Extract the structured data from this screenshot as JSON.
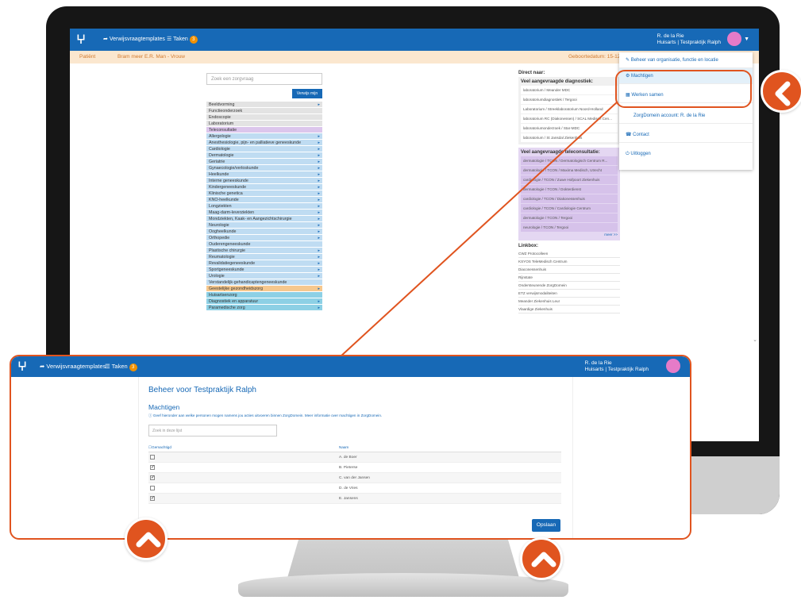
{
  "topbar": {
    "nav_questions": "Verwijsvraagtemplates",
    "nav_tasks": "Taken",
    "tasks_count": "3",
    "user_name": "R. de la Rie",
    "user_org": "Huisarts | Testpraktijk Ralph"
  },
  "patientbar": {
    "patient_label": "Patiënt",
    "patient_name": "Bram meer E.R. Man - Vrouw",
    "birth_label": "Geboortedatum: 15-12-"
  },
  "main": {
    "search_placeholder": "Zoek een zorgvraag",
    "search_button": "Verwijs mijn",
    "specialties": [
      {
        "label": "Beeldvorming",
        "c": "gray",
        "arrow": true
      },
      {
        "label": "Functieonderzoek",
        "c": "gray",
        "arrow": false
      },
      {
        "label": "Endoscopie",
        "c": "gray",
        "arrow": false
      },
      {
        "label": "Laboratorium",
        "c": "gray",
        "arrow": false
      },
      {
        "label": "Teleconsultatie",
        "c": "lav",
        "arrow": false
      },
      {
        "label": "Allergologie",
        "c": "blue",
        "arrow": true
      },
      {
        "label": "Anesthesiologie, pijn- en palliatieve geneeskunde",
        "c": "blue",
        "arrow": true
      },
      {
        "label": "Cardiologie",
        "c": "blue",
        "arrow": true
      },
      {
        "label": "Dermatologie",
        "c": "blue",
        "arrow": true
      },
      {
        "label": "Geriatrie",
        "c": "blue",
        "arrow": true
      },
      {
        "label": "Gynaecologie/verloskunde",
        "c": "blue",
        "arrow": true
      },
      {
        "label": "Heelkunde",
        "c": "blue",
        "arrow": true
      },
      {
        "label": "Interne geneeskunde",
        "c": "blue",
        "arrow": true
      },
      {
        "label": "Kindergeneeskunde",
        "c": "blue",
        "arrow": true
      },
      {
        "label": "Klinische genetica",
        "c": "blue",
        "arrow": true
      },
      {
        "label": "KNO-heelkunde",
        "c": "blue",
        "arrow": true
      },
      {
        "label": "Longziekten",
        "c": "blue",
        "arrow": true
      },
      {
        "label": "Maag-darm-leverziekten",
        "c": "blue",
        "arrow": true
      },
      {
        "label": "Mondziekten, Kaak- en Aangezichtschirurgie",
        "c": "blue",
        "arrow": true
      },
      {
        "label": "Neurologie",
        "c": "blue",
        "arrow": true
      },
      {
        "label": "Oogheelkunde",
        "c": "blue",
        "arrow": true
      },
      {
        "label": "Orthopedie",
        "c": "blue",
        "arrow": true
      },
      {
        "label": "Ouderengeneeskunde",
        "c": "blue",
        "arrow": false
      },
      {
        "label": "Plastische chirurgie",
        "c": "blue",
        "arrow": true
      },
      {
        "label": "Reumatologie",
        "c": "blue",
        "arrow": true
      },
      {
        "label": "Revalidatiegeneeskunde",
        "c": "blue",
        "arrow": true
      },
      {
        "label": "Sportgeneeskunde",
        "c": "blue",
        "arrow": true
      },
      {
        "label": "Urologie",
        "c": "blue",
        "arrow": true
      },
      {
        "label": "Verstandelijk-gehandicaptengeneeskunde",
        "c": "blue",
        "arrow": false
      },
      {
        "label": "Geestelijke gezondheidszorg",
        "c": "orange",
        "arrow": true
      },
      {
        "label": "Huisartsenzorg",
        "c": "teal",
        "arrow": false
      },
      {
        "label": "Diagnostiek en apparatuur",
        "c": "teal",
        "arrow": true
      },
      {
        "label": "Paramedische zorg",
        "c": "teal",
        "arrow": true
      }
    ]
  },
  "direct": {
    "title": "Direct naar:",
    "diag_title": "Veel aangevraagde diagnostiek:",
    "diag_items": [
      "laboratorium / Meander MDC",
      "laboratoriumdiagnostiek / Tergooi",
      "Laboratorium / Streeklaboratorium Noord-Holland",
      "laboratorium RC (Diakonessen) / SCAL Medisch Cen...",
      "laboratoriumonderzoek / Star-MDC",
      "laboratorium / St Jansdal Ziekenhuis"
    ],
    "tele_title": "Veel aangevraagde teleconsultatie:",
    "tele_items": [
      "dermatologie / TCON / Dermatologisch Centrum R...",
      "dermatologie / TCON / Maxima Medisch, Utrecht",
      "cardiologie / TCON / Zuwe Hofpoort Ziekenhuis",
      "dermatologie / TCON / Dokterdienst",
      "cardiologie / TCON / Diakonessenhuis",
      "cardiologie / TCON / Cardiologie Centrum",
      "dermatologie / TCON / Tergooi",
      "neurologie / TCON / Tergooi"
    ],
    "more": "meer >>",
    "links_title": "Linkbox:",
    "links": [
      "CWZ Protocolleen",
      "KSYOS TeleMedisch Centrum",
      "Diaconessenhuis",
      "Rijnstate",
      "Ondersteunende ZorgDomein",
      "ETZ verwijsmodaliteiten",
      "Meander Ziekenhuis Leur",
      "Vlaardige Ziekenhuis"
    ]
  },
  "dropdown": {
    "item_manage": "Beheer van organisatie, functie en locatie",
    "item_authorize": "Machtigen",
    "item_shared": "Werken samen",
    "item_account": "ZorgDomein account: R. de la Rie",
    "item_contact": "Contact",
    "item_logout": "Uitloggen"
  },
  "zoom": {
    "nav_questions": "Verwijsvraagtemplates",
    "nav_tasks": "Taken",
    "tasks_count": "3",
    "user_name": "R. de la Rie",
    "user_org": "Huisarts | Testpraktijk Ralph",
    "heading": "Beheer voor Testpraktijk Ralph",
    "subheading": "Machtigen",
    "info": "Geef hieronder aan welke personen mogen namens jou acties uitvoeren binnen ZorgDomein. Meer informatie over machtigen in ZorgDomein.",
    "search_placeholder": "Zoek in deze lijst",
    "col_authorized": "Gemachtigd",
    "col_name": "Naam",
    "rows": [
      {
        "checked": false,
        "name": "A. de Boer"
      },
      {
        "checked": true,
        "name": "B. Pieterse"
      },
      {
        "checked": true,
        "name": "C. van der Jansen"
      },
      {
        "checked": false,
        "name": "D. de Vries"
      },
      {
        "checked": true,
        "name": "E. Jansens"
      }
    ],
    "save_button": "Opslaan"
  },
  "colors": {
    "brand_blue": "#1769b6",
    "callout_orange": "#e0541f",
    "avatar_pink": "#e67bc8",
    "tasks_badge": "#f29100"
  },
  "icons": [
    "logo-icon",
    "share-arrow-icon",
    "tasks-icon",
    "chevron-left-icon",
    "chevron-up-icon"
  ]
}
